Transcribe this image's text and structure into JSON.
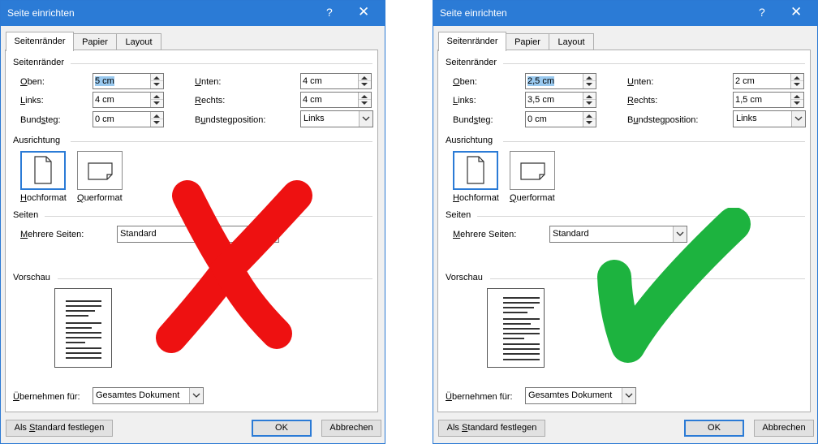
{
  "dialogs": [
    {
      "title": "Seite einrichten",
      "help_glyph": "?",
      "close_glyph": "✕",
      "tabs": [
        "Seitenränder",
        "Papier",
        "Layout"
      ],
      "margins_section": "Seitenränder",
      "labels": {
        "top": "Oben:",
        "bottom": "Unten:",
        "left": "Links:",
        "right": "Rechts:",
        "gutter": "Bundsteg:",
        "gutter_pos": "Bundstegposition:"
      },
      "values": {
        "top": "5 cm",
        "bottom": "4 cm",
        "left": "4 cm",
        "right": "4 cm",
        "gutter": "0 cm",
        "gutter_pos": "Links"
      },
      "orientation_section": "Ausrichtung",
      "portrait_label": "Hochformat",
      "landscape_label": "Querformat",
      "pages_section": "Seiten",
      "multiple_pages_label": "Mehrere Seiten:",
      "multiple_pages_value": "Standard",
      "preview_section": "Vorschau",
      "apply_label": "Übernehmen für:",
      "apply_value": "Gesamtes Dokument",
      "set_default_button": "Als Standard festlegen",
      "ok_button": "OK",
      "cancel_button": "Abbrechen",
      "verdict": "wrong",
      "verdict_color": "#ee1111"
    },
    {
      "title": "Seite einrichten",
      "help_glyph": "?",
      "close_glyph": "✕",
      "tabs": [
        "Seitenränder",
        "Papier",
        "Layout"
      ],
      "margins_section": "Seitenränder",
      "labels": {
        "top": "Oben:",
        "bottom": "Unten:",
        "left": "Links:",
        "right": "Rechts:",
        "gutter": "Bundsteg:",
        "gutter_pos": "Bundstegposition:"
      },
      "values": {
        "top": "2,5 cm",
        "bottom": "2 cm",
        "left": "3,5 cm",
        "right": "1,5 cm",
        "gutter": "0 cm",
        "gutter_pos": "Links"
      },
      "orientation_section": "Ausrichtung",
      "portrait_label": "Hochformat",
      "landscape_label": "Querformat",
      "pages_section": "Seiten",
      "multiple_pages_label": "Mehrere Seiten:",
      "multiple_pages_value": "Standard",
      "preview_section": "Vorschau",
      "apply_label": "Übernehmen für:",
      "apply_value": "Gesamtes Dokument",
      "set_default_button": "Als Standard festlegen",
      "ok_button": "OK",
      "cancel_button": "Abbrechen",
      "verdict": "correct",
      "verdict_color": "#1db33f"
    }
  ]
}
